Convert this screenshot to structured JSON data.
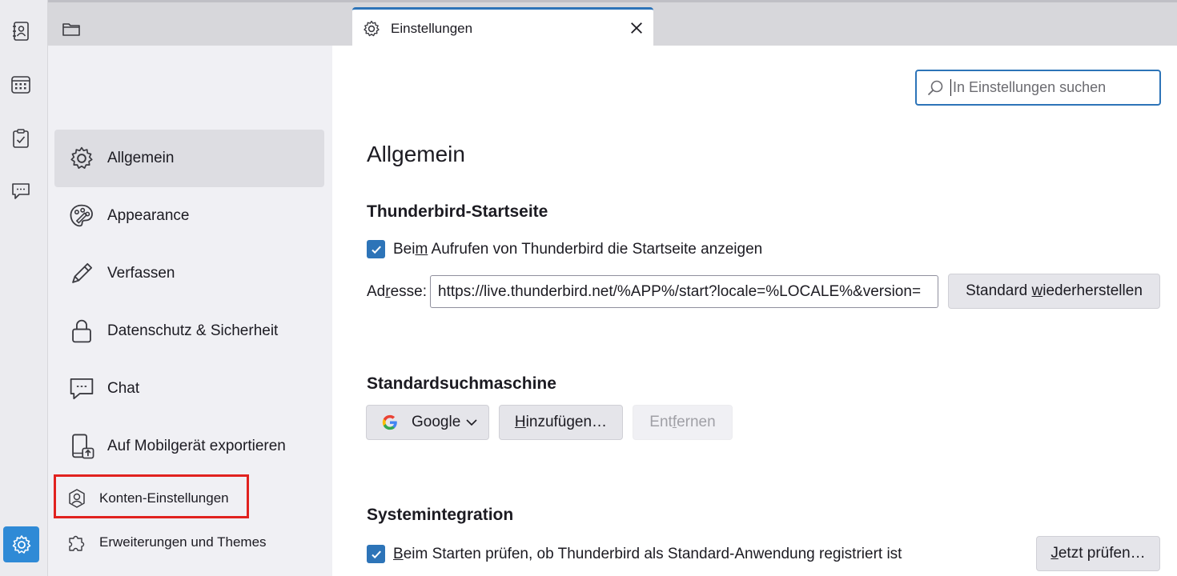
{
  "spaces": {
    "items": [
      {
        "name": "address-book"
      },
      {
        "name": "calendar"
      },
      {
        "name": "tasks"
      },
      {
        "name": "chat"
      }
    ],
    "settings_active": true
  },
  "tab": {
    "title": "Einstellungen"
  },
  "categories": [
    {
      "label": "Allgemein",
      "icon": "gear-icon",
      "selected": true
    },
    {
      "label": "Appearance",
      "icon": "palette-icon",
      "selected": false
    },
    {
      "label": "Verfassen",
      "icon": "pencil-icon",
      "selected": false
    },
    {
      "label": "Datenschutz & Sicherheit",
      "icon": "lock-icon",
      "selected": false
    },
    {
      "label": "Chat",
      "icon": "chat-icon",
      "selected": false
    },
    {
      "label": "Auf Mobilgerät exportieren",
      "icon": "mobile-export-icon",
      "selected": false
    }
  ],
  "footer_categories": [
    {
      "label": "Konten-Einstellungen",
      "icon": "account-icon",
      "highlighted": true
    },
    {
      "label": "Erweiterungen und Themes",
      "icon": "puzzle-icon",
      "highlighted": false
    }
  ],
  "search": {
    "placeholder": "In Einstellungen suchen"
  },
  "main": {
    "heading": "Allgemein",
    "startpage": {
      "title": "Thunderbird-Startseite",
      "checkbox_label_pre": "Bei",
      "checkbox_label_accel": "m",
      "checkbox_label_post": " Aufrufen von Thunderbird die Startseite anzeigen",
      "checked": true,
      "address_label_pre": "Ad",
      "address_label_accel": "r",
      "address_label_post": "esse:",
      "address_value": "https://live.thunderbird.net/%APP%/start?locale=%LOCALE%&version=",
      "restore_pre": "Standard ",
      "restore_accel": "w",
      "restore_post": "iederherstellen"
    },
    "search_engine": {
      "title": "Standardsuchmaschine",
      "selected_engine": "Google",
      "add_pre": "",
      "add_accel": "H",
      "add_post": "inzufügen…",
      "remove_pre": "Ent",
      "remove_accel": "f",
      "remove_post": "ernen"
    },
    "system_integration": {
      "title": "Systemintegration",
      "checkbox_label_pre": "",
      "checkbox_label_accel": "B",
      "checkbox_label_post": "eim Starten prüfen, ob Thunderbird als Standard-Anwendung registriert ist",
      "checked": true,
      "check_now_pre": "",
      "check_now_accel": "J",
      "check_now_post": "etzt prüfen…"
    }
  },
  "colors": {
    "accent": "#2d74b8",
    "highlight_box": "#e1221f",
    "settings_space_bg": "#2f8ad6"
  }
}
